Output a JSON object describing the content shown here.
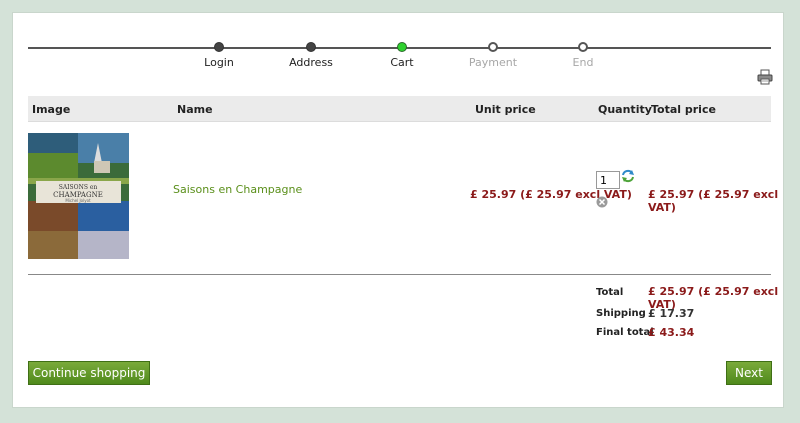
{
  "steps": [
    {
      "label": "Login",
      "state": "done"
    },
    {
      "label": "Address",
      "state": "done"
    },
    {
      "label": "Cart",
      "state": "active"
    },
    {
      "label": "Payment",
      "state": "future"
    },
    {
      "label": "End",
      "state": "future"
    }
  ],
  "icons": {
    "print": "print-icon",
    "refresh": "refresh-icon",
    "remove": "remove-icon"
  },
  "table": {
    "headers": {
      "image": "Image",
      "name": "Name",
      "unit_price": "Unit price",
      "quantity": "Quantity",
      "total_price": "Total price"
    },
    "rows": [
      {
        "name": "Saisons en Champagne",
        "cover_title_1": "SAISONS en",
        "cover_title_2": "CHAMPAGNE",
        "cover_author": "Michel Jolyot",
        "unit_price": "£ 25.97 (£ 25.97 excl VAT)",
        "quantity": "1",
        "total": "£ 25.97 (£ 25.97 excl VAT)"
      }
    ]
  },
  "totals": {
    "total_label": "Total",
    "total_value": "£ 25.97 (£ 25.97 excl VAT)",
    "shipping_label": "Shipping",
    "shipping_value": "£ 17.37",
    "final_label": "Final total",
    "final_value": "£ 43.34"
  },
  "buttons": {
    "continue": "Continue shopping",
    "next": "Next"
  },
  "colors": {
    "accent_green": "#5a8f1a",
    "price_red": "#8b1a1a",
    "active_step": "#2fd12f"
  }
}
